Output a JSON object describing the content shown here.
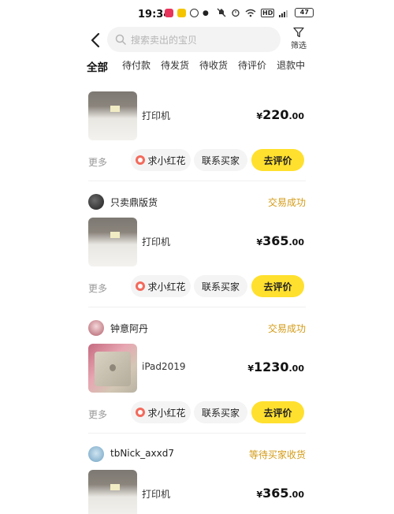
{
  "status_bar": {
    "time": "19:34",
    "battery": "47"
  },
  "search": {
    "placeholder": "搜索卖出的宝贝"
  },
  "filter": {
    "label": "筛选"
  },
  "tabs": [
    {
      "label": "全部",
      "active": true
    },
    {
      "label": "待付款"
    },
    {
      "label": "待发货"
    },
    {
      "label": "待收货"
    },
    {
      "label": "待评价"
    },
    {
      "label": "退款中"
    }
  ],
  "orders": [
    {
      "seller": "",
      "status": "",
      "title": "打印机",
      "price": {
        "currency": "¥",
        "integer": "220",
        "decimal": ".00"
      },
      "actions": {
        "more": "更多",
        "flower": "求小红花",
        "contact": "联系买家",
        "review": "去评价"
      }
    },
    {
      "seller": "只卖鼎版货",
      "status": "交易成功",
      "title": "打印机",
      "price": {
        "currency": "¥",
        "integer": "365",
        "decimal": ".00"
      },
      "actions": {
        "more": "更多",
        "flower": "求小红花",
        "contact": "联系买家",
        "review": "去评价"
      }
    },
    {
      "seller": "钟意阿丹",
      "status": "交易成功",
      "title": "iPad2019",
      "price": {
        "currency": "¥",
        "integer": "1230",
        "decimal": ".00"
      },
      "actions": {
        "more": "更多",
        "flower": "求小红花",
        "contact": "联系买家",
        "review": "去评价"
      }
    },
    {
      "seller": "tbNick_axxd7",
      "status": "等待买家收货",
      "title": "打印机",
      "price": {
        "currency": "¥",
        "integer": "365",
        "decimal": ".00"
      }
    }
  ],
  "colors": {
    "accent_yellow": "#ffe02e",
    "status_gold": "#d39b17"
  }
}
